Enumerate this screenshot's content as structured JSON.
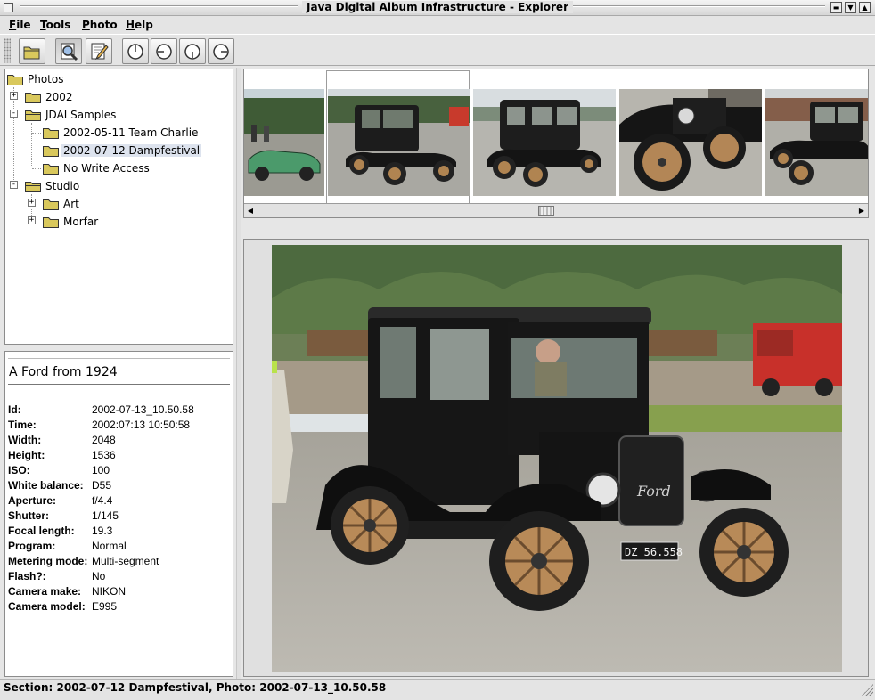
{
  "window": {
    "title": "Java Digital Album Infrastructure - Explorer",
    "buttons": [
      "minimize",
      "maximize",
      "close"
    ]
  },
  "menu": {
    "items": [
      {
        "label": "File",
        "mnemonic": "F"
      },
      {
        "label": "Tools",
        "mnemonic": "T"
      },
      {
        "label": "Photo",
        "mnemonic": "P"
      },
      {
        "label": "Help",
        "mnemonic": "H"
      }
    ]
  },
  "toolbar": {
    "buttons": [
      {
        "icon": "folder-open-icon"
      },
      {
        "icon": "magnifier-icon",
        "pressed": true
      },
      {
        "icon": "edit-pencil-icon"
      },
      {
        "icon": "rotate-up-icon"
      },
      {
        "icon": "rotate-left-icon"
      },
      {
        "icon": "rotate-down-icon"
      },
      {
        "icon": "rotate-right-icon"
      }
    ]
  },
  "tree": {
    "nodes": [
      {
        "label": "Photos",
        "level": 0,
        "expander": "none",
        "selected": false
      },
      {
        "label": "2002",
        "level": 1,
        "expander": "+",
        "selected": false
      },
      {
        "label": "JDAI Samples",
        "level": 1,
        "expander": "-",
        "selected": false
      },
      {
        "label": "2002-05-11 Team Charlie",
        "level": 2,
        "expander": "none",
        "selected": false
      },
      {
        "label": "2002-07-12 Dampfestival",
        "level": 2,
        "expander": "none",
        "selected": true
      },
      {
        "label": "No Write Access",
        "level": 2,
        "expander": "none",
        "selected": false
      },
      {
        "label": "Studio",
        "level": 1,
        "expander": "-",
        "selected": false
      },
      {
        "label": "Art",
        "level": 2,
        "expander": "+",
        "selected": false
      },
      {
        "label": "Morfar",
        "level": 2,
        "expander": "+",
        "selected": false
      }
    ]
  },
  "info": {
    "caption": "A Ford from 1924",
    "metadata": [
      {
        "key": "Id:",
        "value": "2002-07-13_10.50.58"
      },
      {
        "key": "Time:",
        "value": "2002:07:13 10:50:58"
      },
      {
        "key": "Width:",
        "value": "2048"
      },
      {
        "key": "Height:",
        "value": "1536"
      },
      {
        "key": "ISO:",
        "value": "100"
      },
      {
        "key": "White balance:",
        "value": "D55"
      },
      {
        "key": "Aperture:",
        "value": "f/4.4"
      },
      {
        "key": "Shutter:",
        "value": "1/145"
      },
      {
        "key": "Focal length:",
        "value": "19.3"
      },
      {
        "key": "Program:",
        "value": "Normal"
      },
      {
        "key": "Metering mode:",
        "value": "Multi-segment"
      },
      {
        "key": "Flash?:",
        "value": "No"
      },
      {
        "key": "Camera make:",
        "value": "NIKON"
      },
      {
        "key": "Camera model:",
        "value": "E995"
      }
    ]
  },
  "thumbnails": {
    "items": [
      {
        "subject": "green-roadster",
        "selected": false
      },
      {
        "subject": "model-t-front-quarter",
        "selected": true
      },
      {
        "subject": "model-t-rear-quarter",
        "selected": false
      },
      {
        "subject": "model-t-wheel-closeup",
        "selected": false
      },
      {
        "subject": "model-t-side",
        "selected": false
      }
    ]
  },
  "photo": {
    "plate": "DZ 56.558",
    "grille_script": "Ford"
  },
  "status": {
    "text": "Section: 2002-07-12 Dampfestival, Photo: 2002-07-13_10.50.58"
  },
  "colors": {
    "selection": "#dde3ee",
    "folder": "#d9c85c",
    "chrome": "#e4e4e4"
  }
}
